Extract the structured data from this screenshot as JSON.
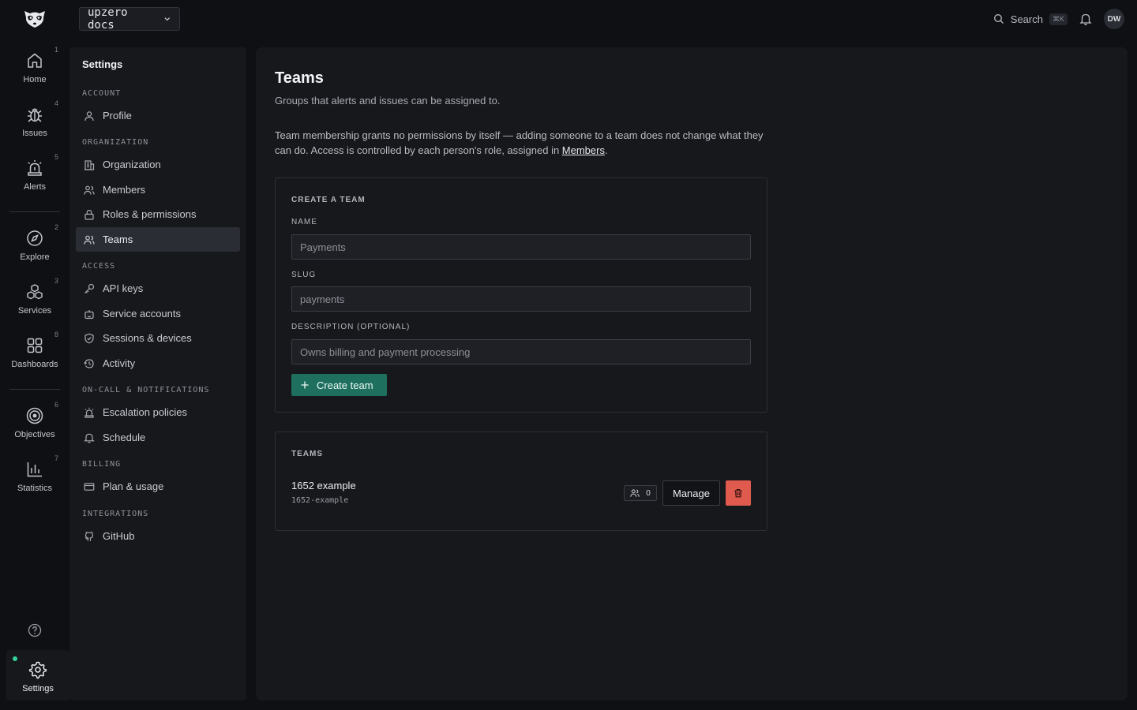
{
  "topbar": {
    "project": "upzero docs",
    "search_label": "Search",
    "search_shortcut": "⌘K",
    "avatar_initials": "DW"
  },
  "rail": {
    "items": [
      {
        "label": "Home",
        "shortcut": "1",
        "icon": "home-icon"
      },
      {
        "label": "Issues",
        "shortcut": "4",
        "icon": "bug-icon"
      },
      {
        "label": "Alerts",
        "shortcut": "5",
        "icon": "siren-icon"
      },
      {
        "label": "Explore",
        "shortcut": "2",
        "icon": "compass-icon"
      },
      {
        "label": "Services",
        "shortcut": "3",
        "icon": "boxes-icon"
      },
      {
        "label": "Dashboards",
        "shortcut": "8",
        "icon": "grid-icon"
      },
      {
        "label": "Objectives",
        "shortcut": "6",
        "icon": "target-icon"
      },
      {
        "label": "Statistics",
        "shortcut": "7",
        "icon": "bar-chart-icon"
      }
    ],
    "settings_label": "Settings"
  },
  "settings_nav": {
    "title": "Settings",
    "sections": {
      "account": "ACCOUNT",
      "organization": "ORGANIZATION",
      "access": "ACCESS",
      "oncall": "ON-CALL & NOTIFICATIONS",
      "billing": "BILLING",
      "integrations": "INTEGRATIONS"
    },
    "items": {
      "profile": "Profile",
      "organization": "Organization",
      "members": "Members",
      "roles": "Roles & permissions",
      "teams": "Teams",
      "api_keys": "API keys",
      "service_accounts": "Service accounts",
      "sessions": "Sessions & devices",
      "activity": "Activity",
      "escalation": "Escalation policies",
      "schedule": "Schedule",
      "plan": "Plan & usage",
      "github": "GitHub"
    }
  },
  "main": {
    "title": "Teams",
    "subtitle": "Groups that alerts and issues can be assigned to.",
    "note_text": "Team membership grants no permissions by itself — adding someone to a team does not change what they can do. Access is controlled by each person's role, assigned in ",
    "note_link": "Members",
    "note_end": "."
  },
  "create_form": {
    "heading": "CREATE A TEAM",
    "name_label": "NAME",
    "name_placeholder": "Payments",
    "slug_label": "SLUG",
    "slug_placeholder": "payments",
    "description_label": "DESCRIPTION (OPTIONAL)",
    "description_placeholder": "Owns billing and payment processing",
    "submit_label": "Create team"
  },
  "teams": {
    "heading": "TEAMS",
    "list": [
      {
        "name": "1652 example",
        "slug": "1652-example",
        "member_count": "0"
      }
    ],
    "manage_label": "Manage"
  },
  "colors": {
    "accent_green": "#1f6f5f",
    "danger_red": "#e05a4e",
    "status_green": "#34d399"
  }
}
